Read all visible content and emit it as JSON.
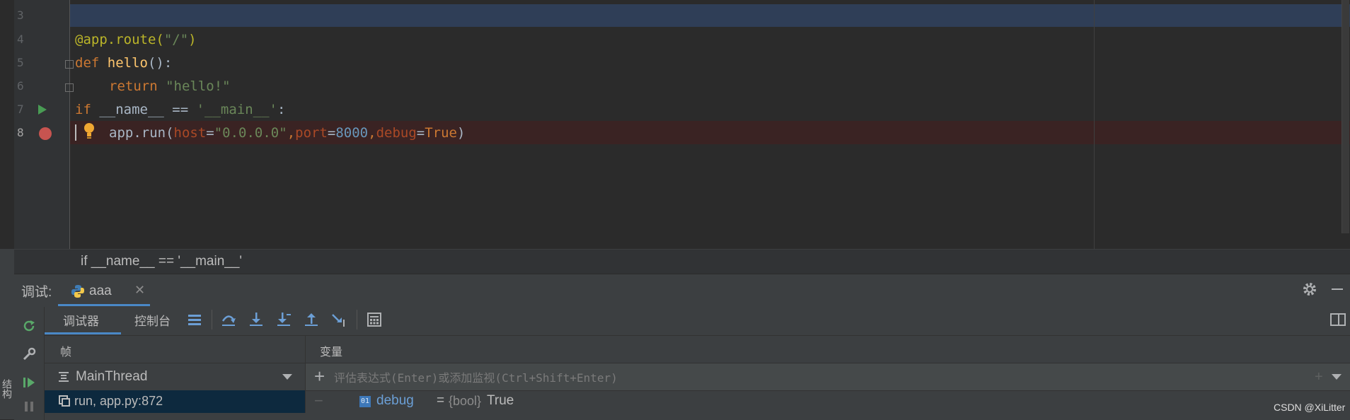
{
  "editor": {
    "lines": [
      {
        "num": "3"
      },
      {
        "num": "4"
      },
      {
        "num": "5"
      },
      {
        "num": "6"
      },
      {
        "num": "7"
      },
      {
        "num": "8"
      }
    ],
    "code": {
      "l4_dec": "@app.route(",
      "l4_str": "\"/\"",
      "l4_end": ")",
      "l5_kw": "def ",
      "l5_fn": "hello",
      "l5_end": "():",
      "l6_kw": "return ",
      "l6_str": "\"hello!\"",
      "l7_kw": "if ",
      "l7_mid": "__name__ == ",
      "l7_str": "'__main__'",
      "l7_end": ":",
      "l8_pre": "app.run(",
      "l8_p1": "host",
      "l8_eq1": "=",
      "l8_s1": "\"0.0.0.0\"",
      "l8_c1": ",",
      "l8_p2": "port",
      "l8_eq2": "=",
      "l8_n2": "8000",
      "l8_c2": ",",
      "l8_p3": "debug",
      "l8_eq3": "=",
      "l8_k3": "True",
      "l8_end": ")"
    }
  },
  "breadcrumb": {
    "text": "if __name__ == '__main__'"
  },
  "debug": {
    "title": "调试:",
    "session_name": "aaa",
    "close_glyph": "✕",
    "tabs": {
      "debugger": "调试器",
      "console": "控制台"
    },
    "frames_header": "帧",
    "variables_header": "变量",
    "thread": "MainThread",
    "frame": "run, app.py:872",
    "watch_placeholder": "评估表达式(Enter)或添加监视(Ctrl+Shift+Enter)",
    "variable": {
      "badge": "01",
      "name": "debug",
      "eq": " = ",
      "type": "{bool}",
      "value": "True"
    }
  },
  "side_label": "结构",
  "watermark": "CSDN @XiLitter",
  "colors": {
    "keyword": "#cc7832",
    "string": "#6a8759",
    "decorator": "#bbb529",
    "number": "#6897bb",
    "param": "#aa4926",
    "breakpoint": "#c75450",
    "run_arrow": "#499c54",
    "accent": "#4a88c7"
  },
  "icons": [
    "run-arrow-icon",
    "breakpoint-icon",
    "bulb-icon",
    "python-icon",
    "gear-icon",
    "rerun-icon",
    "wrench-icon",
    "resume-icon",
    "pause-icon",
    "step-over-icon",
    "step-into-icon",
    "step-into-my-code-icon",
    "step-out-icon",
    "run-to-cursor-icon",
    "evaluate-icon",
    "layout-icon"
  ]
}
